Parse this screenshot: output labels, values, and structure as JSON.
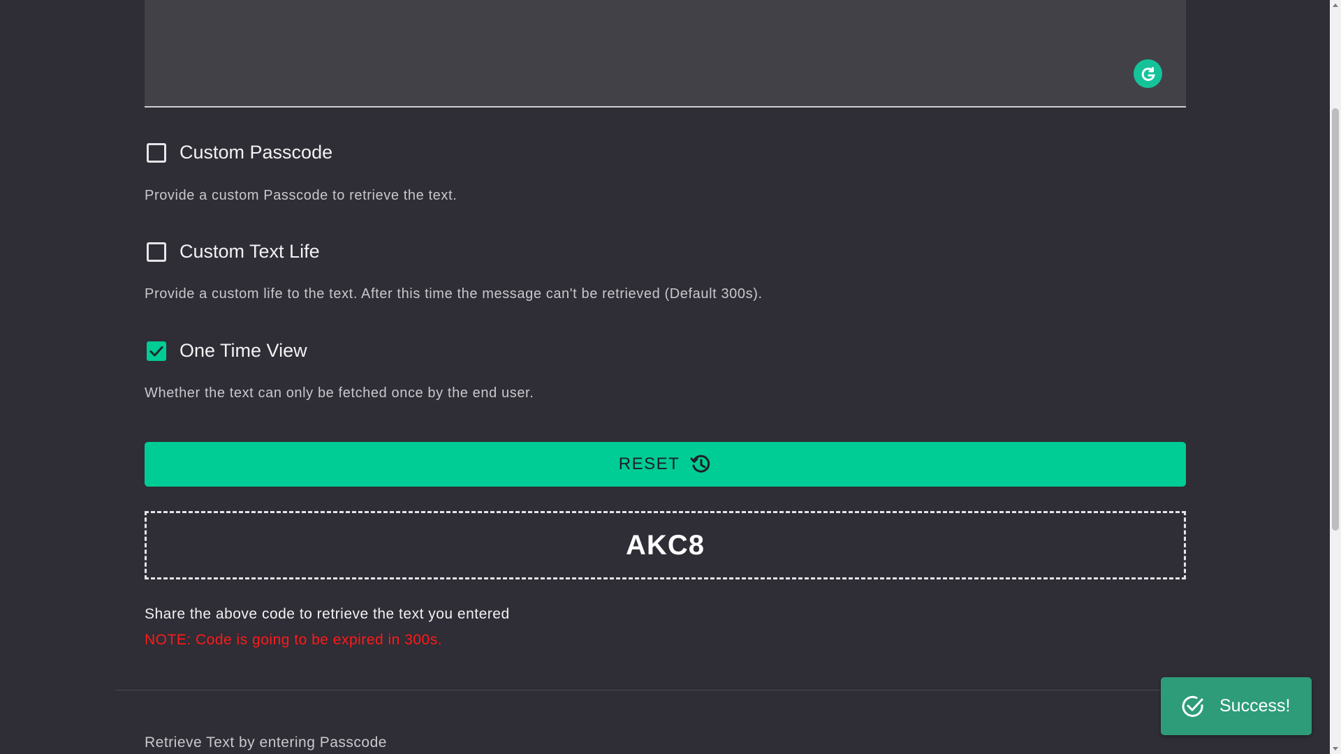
{
  "colors": {
    "accent": "#00cc96",
    "background": "#2f2d35",
    "note": "#ff1a1a",
    "toast": "#2e9c79"
  },
  "editor": {
    "value": "",
    "badge_icon": "grammarly-icon"
  },
  "options": [
    {
      "label": "Custom Passcode",
      "checked": false,
      "description": "Provide a custom Passcode to retrieve the text."
    },
    {
      "label": "Custom Text Life",
      "checked": false,
      "description": "Provide a custom life to the text. After this time the message can't be retrieved (Default 300s)."
    },
    {
      "label": "One Time View",
      "checked": true,
      "description": "Whether the text can only be fetched once by the end user."
    }
  ],
  "reset_button": {
    "label": "RESET",
    "icon": "history-icon"
  },
  "result": {
    "code": "AKC8",
    "share_text": "Share the above code to retrieve the text you entered",
    "note": "NOTE: Code is going to be expired in 300s."
  },
  "retrieve": {
    "title": "Retrieve Text by entering Passcode"
  },
  "toast": {
    "message": "Success!",
    "icon": "check-circle-icon"
  }
}
